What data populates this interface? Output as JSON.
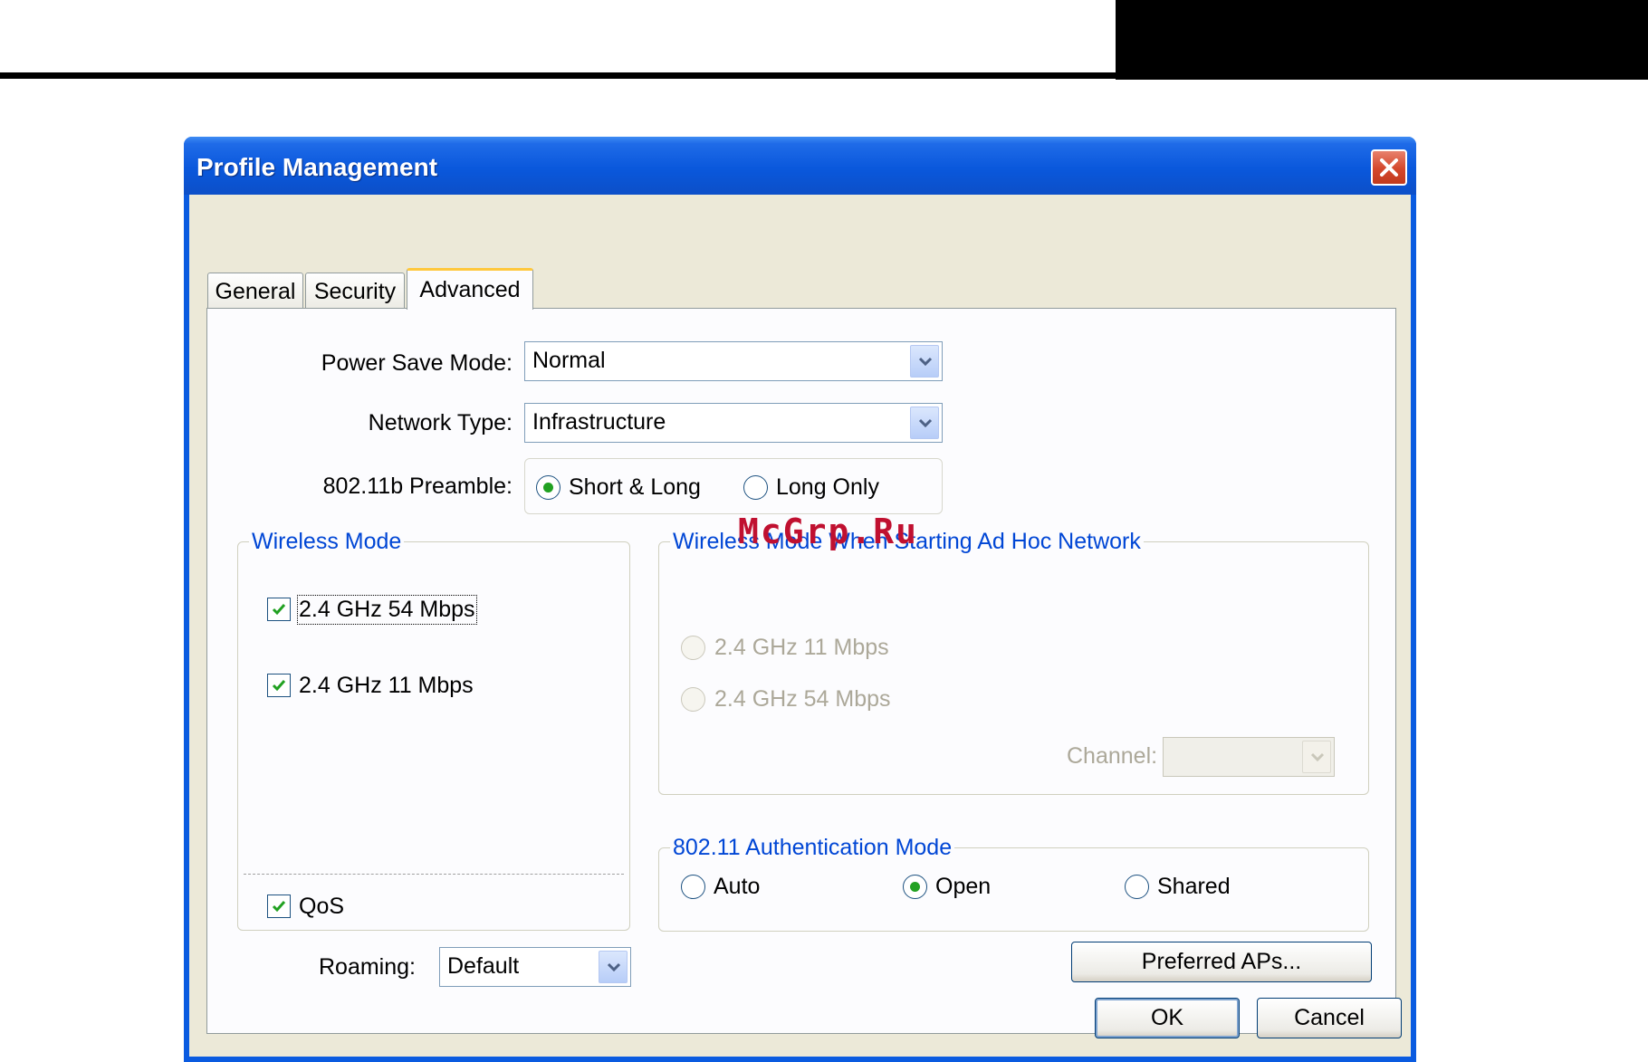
{
  "window": {
    "title": "Profile Management"
  },
  "tabs": [
    {
      "label": "General",
      "active": false
    },
    {
      "label": "Security",
      "active": false
    },
    {
      "label": "Advanced",
      "active": true
    }
  ],
  "power_save": {
    "label": "Power Save Mode:",
    "value": "Normal"
  },
  "network_type": {
    "label": "Network Type:",
    "value": "Infrastructure"
  },
  "preamble": {
    "label": "802.11b Preamble:",
    "options": [
      {
        "label": "Short & Long",
        "selected": true
      },
      {
        "label": "Long Only",
        "selected": false
      }
    ]
  },
  "wireless_mode": {
    "title": "Wireless Mode",
    "options": [
      {
        "label": "2.4 GHz 54 Mbps",
        "checked": true
      },
      {
        "label": "2.4 GHz 11 Mbps",
        "checked": true
      }
    ],
    "qos": {
      "label": "QoS",
      "checked": true
    }
  },
  "adhoc_mode": {
    "title": "Wireless Mode When Starting Ad Hoc Network",
    "options": [
      {
        "label": "2.4 GHz 11 Mbps",
        "selected": false
      },
      {
        "label": "2.4 GHz 54 Mbps",
        "selected": false
      }
    ],
    "channel_label": "Channel:",
    "channel_value": ""
  },
  "auth_mode": {
    "title": "802.11 Authentication Mode",
    "options": [
      {
        "label": "Auto",
        "selected": false
      },
      {
        "label": "Open",
        "selected": true
      },
      {
        "label": "Shared",
        "selected": false
      }
    ]
  },
  "roaming": {
    "label": "Roaming:",
    "value": "Default"
  },
  "buttons": {
    "preferred_aps": "Preferred APs...",
    "ok": "OK",
    "cancel": "Cancel"
  },
  "watermark": "McGrp.Ru",
  "colors": {
    "titlebar": "#0a58dc",
    "group_title": "#0046d5",
    "radio_dot": "#21a121",
    "check": "#21a121"
  },
  "icons": {
    "close": "close-icon",
    "dropdown": "chevron-down-icon",
    "check": "checkmark-icon"
  }
}
